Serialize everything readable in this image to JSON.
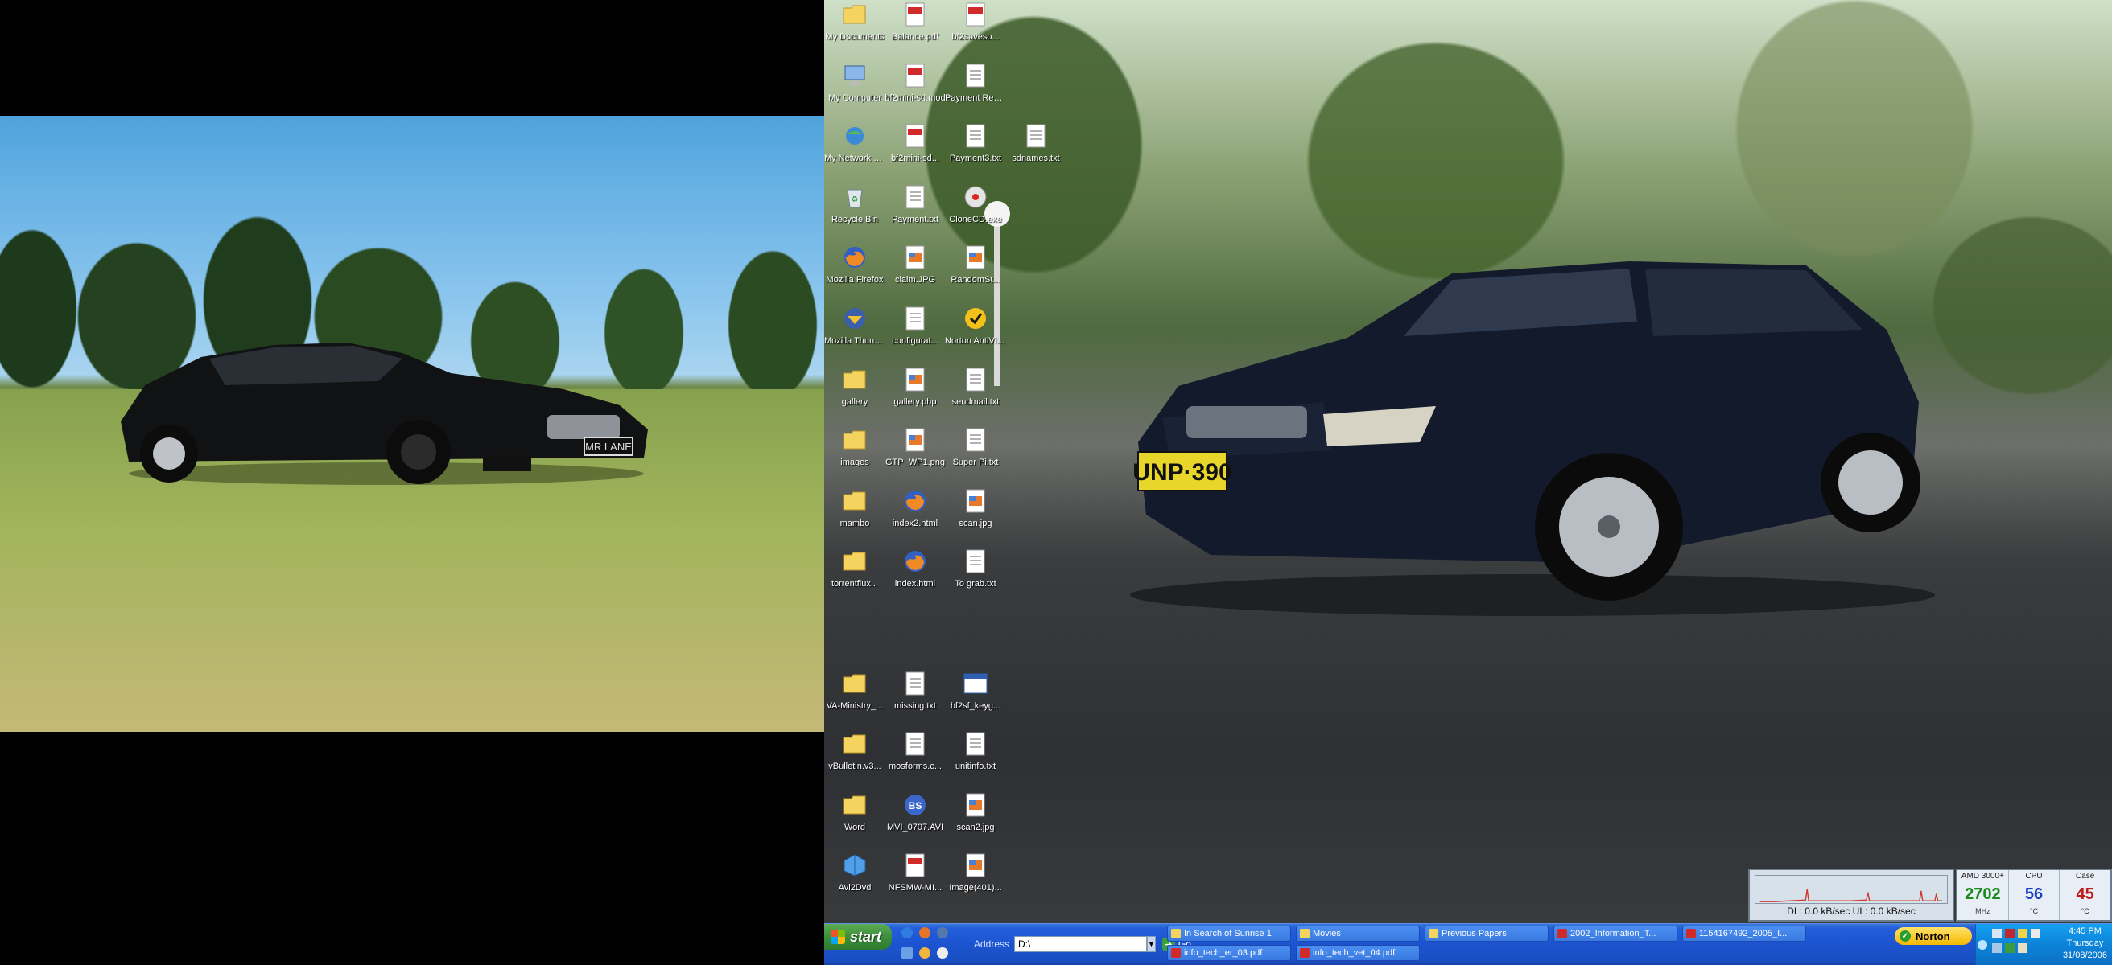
{
  "left_plate": "MR LANE",
  "right_plate": "UNP·390",
  "desktop_icons": [
    {
      "label": "My Documents",
      "icon": "folder-icon",
      "col": 0,
      "row": 0
    },
    {
      "label": "Balance.pdf",
      "icon": "pdf-icon",
      "col": 1,
      "row": 0
    },
    {
      "label": "bf2saveso...",
      "icon": "pdf-icon",
      "col": 2,
      "row": 0
    },
    {
      "label": "My Computer",
      "icon": "computer-icon",
      "col": 0,
      "row": 1
    },
    {
      "label": "bf2mini-sd.mod",
      "icon": "pdf-icon",
      "col": 1,
      "row": 1
    },
    {
      "label": "Payment Receipt.txt",
      "icon": "text-file-icon",
      "col": 2,
      "row": 1
    },
    {
      "label": "My Network Places",
      "icon": "network-icon",
      "col": 0,
      "row": 2
    },
    {
      "label": "bf2mini-sd...",
      "icon": "pdf-icon",
      "col": 1,
      "row": 2
    },
    {
      "label": "Payment3.txt",
      "icon": "text-file-icon",
      "col": 2,
      "row": 2
    },
    {
      "label": "sdnames.txt",
      "icon": "text-file-icon",
      "col": 3,
      "row": 2
    },
    {
      "label": "Recycle Bin",
      "icon": "recycle-bin-icon",
      "col": 0,
      "row": 3
    },
    {
      "label": "Payment.txt",
      "icon": "text-file-icon",
      "col": 1,
      "row": 3
    },
    {
      "label": "CloneCD.exe",
      "icon": "disc-icon",
      "col": 2,
      "row": 3
    },
    {
      "label": "Mozilla Firefox",
      "icon": "firefox-icon",
      "col": 0,
      "row": 4
    },
    {
      "label": "claim.JPG",
      "icon": "image-icon",
      "col": 1,
      "row": 4
    },
    {
      "label": "RandomSt...",
      "icon": "image-icon",
      "col": 2,
      "row": 4
    },
    {
      "label": "Mozilla Thunderbird",
      "icon": "thunderbird-icon",
      "col": 0,
      "row": 5
    },
    {
      "label": "configurat...",
      "icon": "text-file-icon",
      "col": 1,
      "row": 5
    },
    {
      "label": "Norton AntiVirus",
      "icon": "norton-icon",
      "col": 2,
      "row": 5
    },
    {
      "label": "gallery",
      "icon": "folder-icon",
      "col": 0,
      "row": 6
    },
    {
      "label": "gallery.php",
      "icon": "image-icon",
      "col": 1,
      "row": 6
    },
    {
      "label": "sendmail.txt",
      "icon": "text-file-icon",
      "col": 2,
      "row": 6
    },
    {
      "label": "images",
      "icon": "folder-icon",
      "col": 0,
      "row": 7
    },
    {
      "label": "GTP_WP1.png",
      "icon": "image-icon",
      "col": 1,
      "row": 7
    },
    {
      "label": "Super Pi.txt",
      "icon": "text-file-icon",
      "col": 2,
      "row": 7
    },
    {
      "label": "mambo",
      "icon": "folder-icon",
      "col": 0,
      "row": 8
    },
    {
      "label": "index2.html",
      "icon": "firefox-icon",
      "col": 1,
      "row": 8
    },
    {
      "label": "scan.jpg",
      "icon": "image-icon",
      "col": 2,
      "row": 8
    },
    {
      "label": "torrentflux...",
      "icon": "folder-icon",
      "col": 0,
      "row": 9
    },
    {
      "label": "index.html",
      "icon": "firefox-icon",
      "col": 1,
      "row": 9
    },
    {
      "label": "To grab.txt",
      "icon": "text-file-icon",
      "col": 2,
      "row": 9
    },
    {
      "label": "VA-Ministry_...",
      "icon": "folder-icon",
      "col": 0,
      "row": 11
    },
    {
      "label": "missing.txt",
      "icon": "text-file-icon",
      "col": 1,
      "row": 11
    },
    {
      "label": "bf2sf_keyg...",
      "icon": "window-icon",
      "col": 2,
      "row": 11
    },
    {
      "label": "vBulletin.v3...",
      "icon": "folder-icon",
      "col": 0,
      "row": 12
    },
    {
      "label": "mosforms.c...",
      "icon": "text-file-icon",
      "col": 1,
      "row": 12
    },
    {
      "label": "unitinfo.txt",
      "icon": "text-file-icon",
      "col": 2,
      "row": 12
    },
    {
      "label": "Word",
      "icon": "folder-icon",
      "col": 0,
      "row": 13
    },
    {
      "label": "MVI_0707.AVI",
      "icon": "bs-player-icon",
      "col": 1,
      "row": 13
    },
    {
      "label": "scan2.jpg",
      "icon": "image-icon",
      "col": 2,
      "row": 13
    },
    {
      "label": "Avi2Dvd",
      "icon": "box-icon",
      "col": 0,
      "row": 14
    },
    {
      "label": "NFSMW-MI...",
      "icon": "pdf-icon",
      "col": 1,
      "row": 14
    },
    {
      "label": "Image(401)...",
      "icon": "image-icon",
      "col": 2,
      "row": 14
    }
  ],
  "net_meter": {
    "text": "DL: 0.0 kB/sec  UL: 0.0 kB/sec"
  },
  "hw_meter": {
    "cols": [
      {
        "head": "AMD 3000+",
        "value": "2702",
        "unit": "MHz",
        "color": "#1a8a1a"
      },
      {
        "head": "CPU",
        "value": "56",
        "unit": "°C",
        "color": "#1b3fc4"
      },
      {
        "head": "Case",
        "value": "45",
        "unit": "°C",
        "color": "#c01b1b"
      }
    ]
  },
  "taskbar": {
    "start_label": "start",
    "address_label": "Address",
    "address_value": "D:\\",
    "go_label": "Go",
    "norton_label": "Norton",
    "clock": {
      "time": "4:45 PM",
      "day": "Thursday",
      "date": "31/08/2006"
    },
    "tasks": [
      {
        "label": "In Search of Sunrise 1",
        "icon": "folder-icon"
      },
      {
        "label": "Movies",
        "icon": "folder-icon"
      },
      {
        "label": "Previous Papers",
        "icon": "folder-icon"
      },
      {
        "label": "2002_Information_T...",
        "icon": "pdf-icon"
      },
      {
        "label": "1154167492_2005_I...",
        "icon": "pdf-icon"
      },
      {
        "label": "info_tech_er_03.pdf",
        "icon": "pdf-icon"
      },
      {
        "label": "info_tech_vet_04.pdf",
        "icon": "pdf-icon"
      }
    ]
  }
}
